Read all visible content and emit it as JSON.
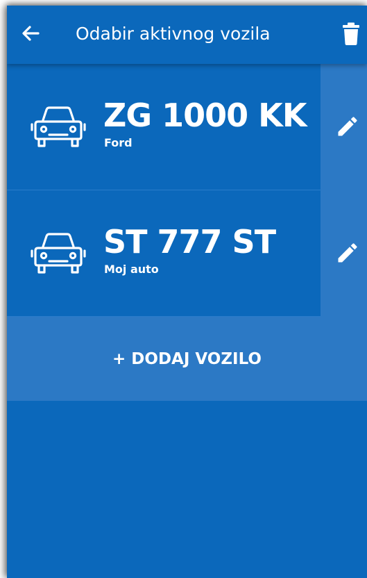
{
  "appbar": {
    "title": "Odabir aktivnog vozila",
    "back_icon": "arrow-left-icon",
    "delete_icon": "trash-icon"
  },
  "vehicles": [
    {
      "plate": "ZG 1000 KK",
      "name": "Ford",
      "icon": "car-icon",
      "edit_icon": "pencil-icon"
    },
    {
      "plate": "ST 777 ST",
      "name": "Moj auto",
      "icon": "car-icon",
      "edit_icon": "pencil-icon"
    }
  ],
  "add_button": {
    "label": "+ DODAJ VOZILO"
  },
  "colors": {
    "primary": "#0b68bb",
    "secondary": "#2c79c5",
    "text": "#ffffff"
  }
}
